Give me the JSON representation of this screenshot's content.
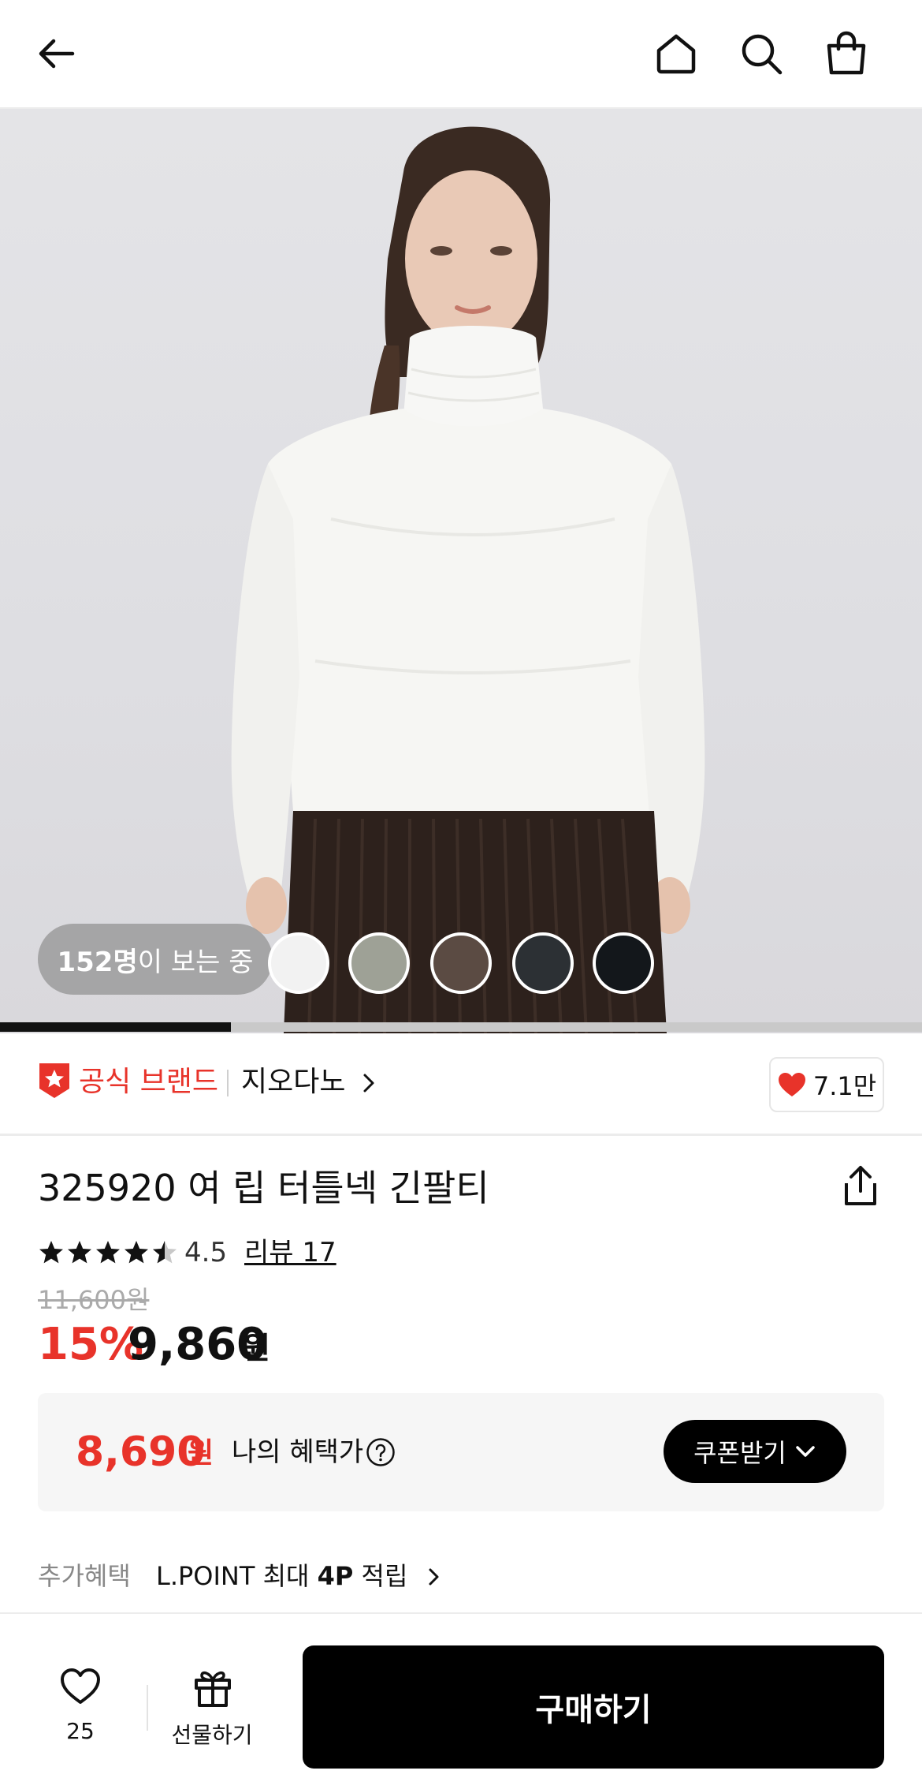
{
  "header": {
    "icons": [
      "back-arrow-icon",
      "home-icon",
      "search-icon",
      "shopping-bag-icon"
    ]
  },
  "hero": {
    "viewers_count": "152명",
    "viewers_suffix": "이 보는 중",
    "swatches": [
      {
        "name": "white",
        "color": "#f2f2f2"
      },
      {
        "name": "gray-green",
        "color": "#9ea196"
      },
      {
        "name": "brown",
        "color": "#5b4b43"
      },
      {
        "name": "charcoal",
        "color": "#2c3034"
      },
      {
        "name": "black",
        "color": "#13171b"
      }
    ],
    "slide_progress": 0.25
  },
  "brand": {
    "official_label": "공식 브랜드",
    "name": "지오다노",
    "like_count": "7.1만"
  },
  "product": {
    "title": "325920 여 립 터틀넥 긴팔티",
    "rating_stars": 4.5,
    "rating": "4.5",
    "review_link": "리뷰 17",
    "original_price": "11,600원",
    "discount": "15%",
    "sale_price": "9,860",
    "sale_currency": "원"
  },
  "benefit": {
    "price": "8,690",
    "currency": "원",
    "label": "나의 혜택가",
    "coupon_button": "쿠폰받기"
  },
  "extra": {
    "label": "추가혜택",
    "text_prefix": "L.POINT 최대 ",
    "text_bold": "4P",
    "text_suffix": " 적립"
  },
  "bottom_bar": {
    "wishlist_count": "25",
    "gift_label": "선물하기",
    "buy_label": "구매하기"
  },
  "colors": {
    "accent_red": "#e8332a",
    "primary_black": "#000000"
  }
}
